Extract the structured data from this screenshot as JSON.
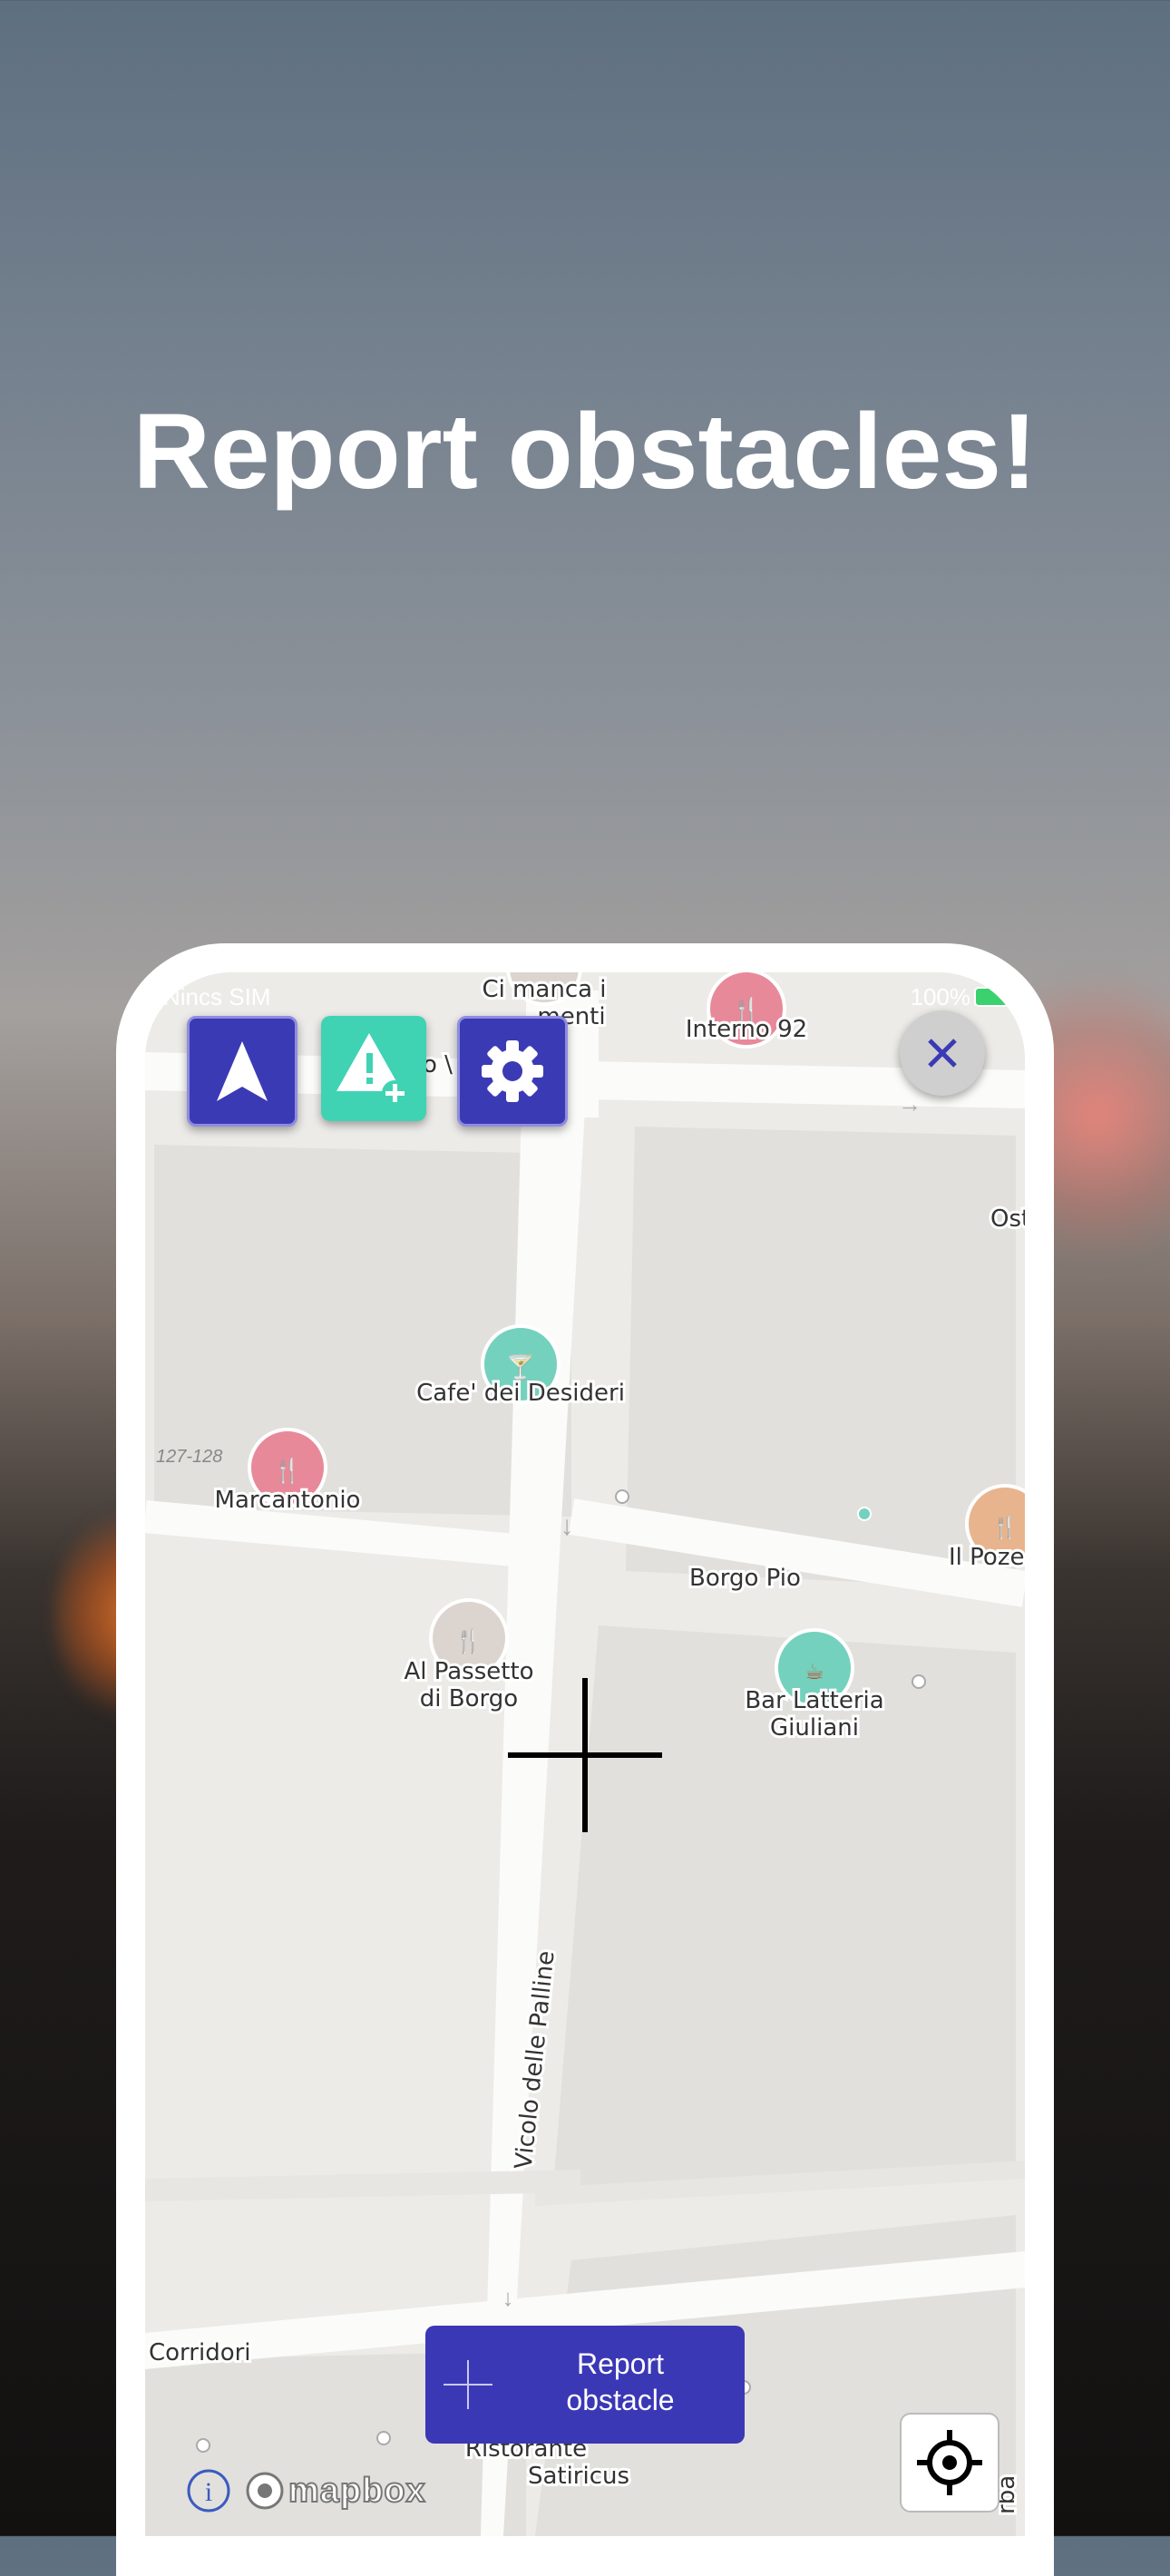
{
  "headline": "Report obstacles!",
  "status_bar": {
    "carrier": "Nincs SIM",
    "battery": "100%"
  },
  "toolbar": {
    "navigate_icon": "navigation-arrow-icon",
    "add_obstacle_icon": "warning-add-icon",
    "settings_icon": "gear-icon"
  },
  "map": {
    "places": [
      {
        "name": "Interno 92",
        "kind": "restaurant"
      },
      {
        "name": "Ci manca i",
        "kind": "restaurant"
      },
      {
        "name": "menti",
        "kind": "street-fragment"
      },
      {
        "name": "Cafe' dei Desideri",
        "kind": "bar"
      },
      {
        "name": "Marcantonio",
        "kind": "restaurant"
      },
      {
        "name": "Al Passetto",
        "kind": "restaurant"
      },
      {
        "name": "di Borgo",
        "kind": "restaurant"
      },
      {
        "name": "Bar Latteria",
        "kind": "cafe"
      },
      {
        "name": "Giuliani",
        "kind": "cafe"
      },
      {
        "name": "Il Poze",
        "kind": "restaurant"
      },
      {
        "name": "Ost",
        "kind": "restaurant"
      },
      {
        "name": "Ristorante",
        "kind": "restaurant"
      },
      {
        "name": "Satiricus",
        "kind": "restaurant"
      }
    ],
    "streets": [
      "Borgo Pio",
      "Vicolo delle Palline",
      "Corridori",
      "o \\",
      "rba"
    ],
    "house_numbers": "127-128",
    "colors": {
      "restaurant": "#e8899a",
      "bar": "#74d1bd",
      "cafe": "#74d1bd",
      "restaurant_alt": "#e7b48d",
      "neutral": "#dcd5cf"
    }
  },
  "report_button": {
    "label_line1": "Report",
    "label_line2": "obstacle"
  },
  "attribution": {
    "brand": "mapbox",
    "info_icon": "info-icon"
  },
  "colors": {
    "primary": "#3b38b6",
    "accent": "#3fd3b4"
  }
}
